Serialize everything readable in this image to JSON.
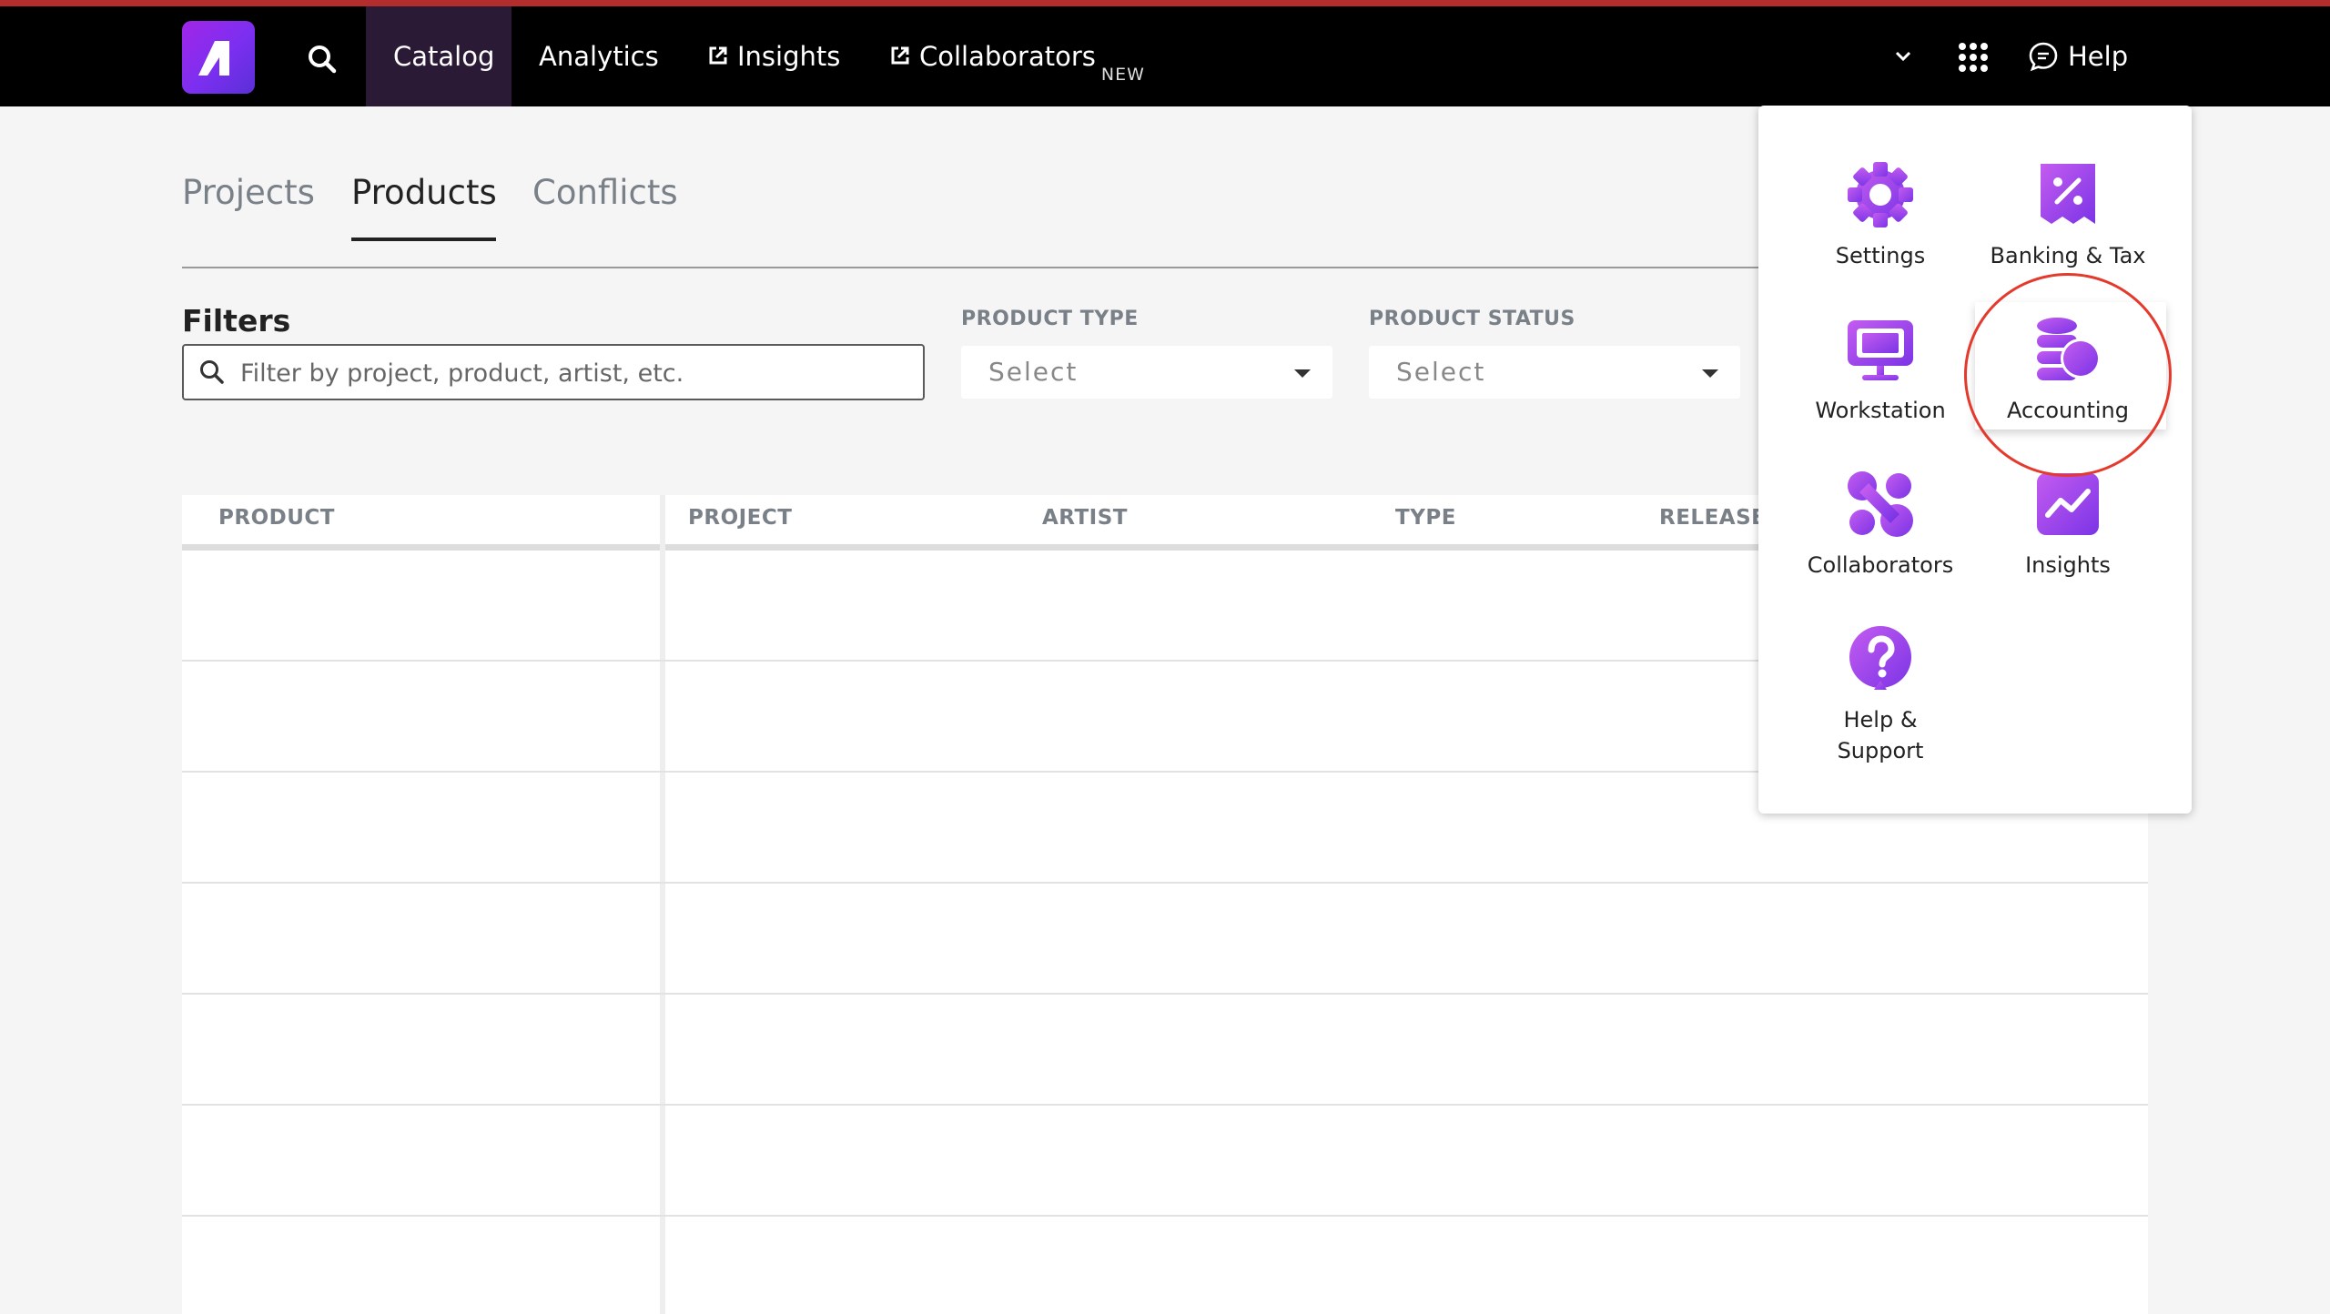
{
  "nav": {
    "items": [
      {
        "label": "Catalog",
        "active": true
      },
      {
        "label": "Analytics"
      },
      {
        "label": "Insights",
        "external": true
      },
      {
        "label": "Collaborators",
        "external": true,
        "badge": "NEW"
      }
    ],
    "help_label": "Help",
    "icons": [
      "logo-icon",
      "search-icon",
      "chevron-down-icon",
      "apps-grid-icon",
      "chat-bubble-icon"
    ]
  },
  "tabs": [
    {
      "label": "Projects"
    },
    {
      "label": "Products",
      "active": true
    },
    {
      "label": "Conflicts"
    }
  ],
  "filters": {
    "title": "Filters",
    "search_placeholder": "Filter by project, product, artist, etc.",
    "product_type": {
      "label": "PRODUCT TYPE",
      "value": "Select"
    },
    "product_status": {
      "label": "PRODUCT STATUS",
      "value": "Select"
    }
  },
  "table": {
    "columns": [
      "PRODUCT",
      "PROJECT",
      "ARTIST",
      "TYPE",
      "RELEASE"
    ],
    "rows": []
  },
  "apps_menu": {
    "items": [
      {
        "label": "Settings",
        "icon": "gear-icon"
      },
      {
        "label": "Banking & Tax",
        "icon": "percent-tag-icon"
      },
      {
        "label": "Workstation",
        "icon": "monitor-icon"
      },
      {
        "label": "Accounting",
        "icon": "coins-icon",
        "highlighted": true
      },
      {
        "label": "Collaborators",
        "icon": "collaborators-icon"
      },
      {
        "label": "Insights",
        "icon": "trend-chart-icon"
      },
      {
        "label": "Help &",
        "label2": "Support",
        "icon": "question-icon"
      }
    ]
  },
  "colors": {
    "brand_purple": "#9b3ef0",
    "nav_bg": "#000000",
    "nav_active": "#2b1a36",
    "top_accent": "#b32d2d",
    "highlight_red": "#e43a2d"
  }
}
